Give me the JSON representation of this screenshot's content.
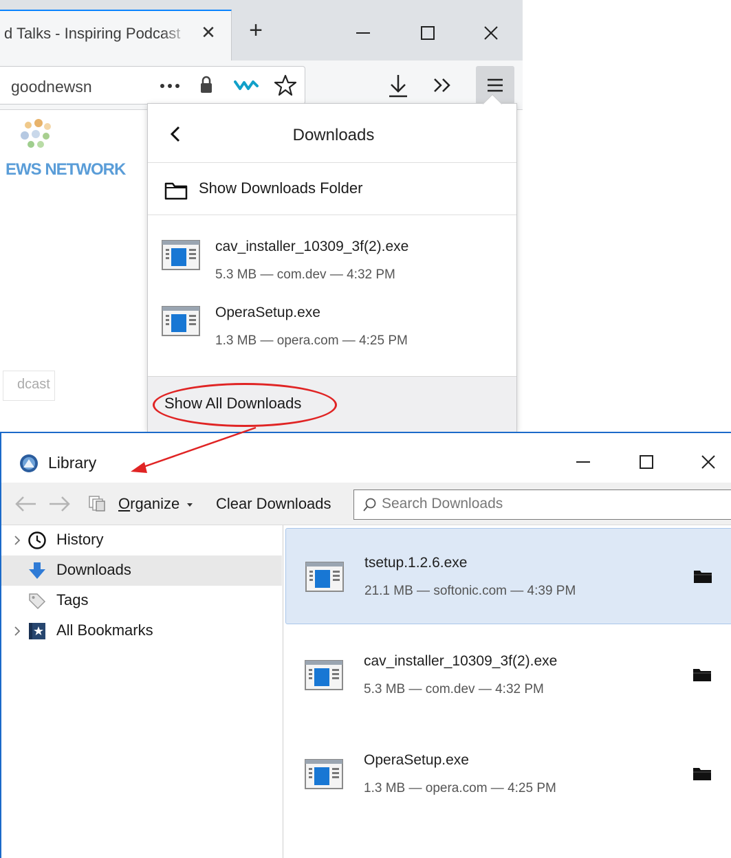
{
  "browser": {
    "tab_title": "d Talks - Inspiring Podcast",
    "tab_close": "✕",
    "new_tab": "+",
    "url_text": "goodnewsn",
    "page_logo_text": "EWS NETWORK",
    "page_tag_text": "dcast"
  },
  "downloads_panel": {
    "title": "Downloads",
    "show_folder_label": "Show Downloads Folder",
    "items": [
      {
        "name": "cav_installer_10309_3f(2).exe",
        "meta": "5.3 MB — com.dev — 4:32 PM"
      },
      {
        "name": "OperaSetup.exe",
        "meta": "1.3 MB — opera.com — 4:25 PM"
      }
    ],
    "show_all_label": "Show All Downloads"
  },
  "library": {
    "title": "Library",
    "toolbar": {
      "organize_label": "Organize",
      "organize_mnemonic": "O",
      "organize_rest": "rganize",
      "clear_label": "Clear Downloads",
      "search_placeholder": "Search Downloads"
    },
    "sidebar": {
      "items": [
        {
          "label": "History"
        },
        {
          "label": "Downloads"
        },
        {
          "label": "Tags"
        },
        {
          "label": "All Bookmarks"
        }
      ]
    },
    "downloads": [
      {
        "name": "tsetup.1.2.6.exe",
        "meta": "21.1 MB — softonic.com — 4:39 PM"
      },
      {
        "name": "cav_installer_10309_3f(2).exe",
        "meta": "5.3 MB — com.dev — 4:32 PM"
      },
      {
        "name": "OperaSetup.exe",
        "meta": "1.3 MB — opera.com — 4:25 PM"
      }
    ]
  },
  "colors": {
    "accent": "#0a84ff",
    "window_border": "#1b6ac9",
    "selected_row": "#dde8f6",
    "annotation_red": "#e02424"
  }
}
